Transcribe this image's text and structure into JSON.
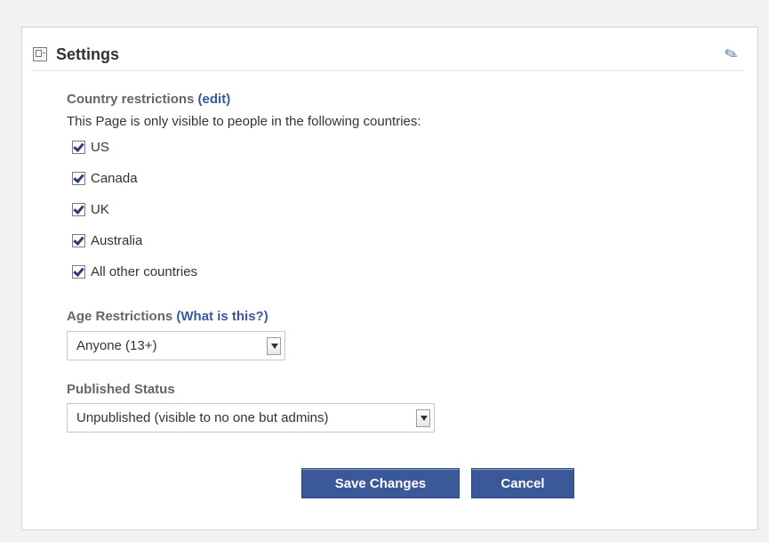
{
  "header": {
    "title": "Settings",
    "icon": "settings-icon",
    "edit_icon": "pencil-icon"
  },
  "country_restrictions": {
    "label": "Country restrictions",
    "link": "(edit)",
    "description": "This Page is only visible to people in the following countries:",
    "countries": [
      {
        "label": "US",
        "checked": true
      },
      {
        "label": "Canada",
        "checked": true
      },
      {
        "label": "UK",
        "checked": true
      },
      {
        "label": "Australia",
        "checked": true
      },
      {
        "label": "All other countries",
        "checked": true
      }
    ]
  },
  "age_restrictions": {
    "label": "Age Restrictions",
    "link": "(What is this?)",
    "selected": "Anyone (13+)"
  },
  "published_status": {
    "label": "Published Status",
    "selected": "Unpublished (visible to no one but admins)"
  },
  "buttons": {
    "save": "Save Changes",
    "cancel": "Cancel"
  },
  "colors": {
    "button_bg": "#3b5998",
    "link": "#3b5998",
    "panel_bg": "#ffffff",
    "page_bg": "#f2f2f2"
  }
}
